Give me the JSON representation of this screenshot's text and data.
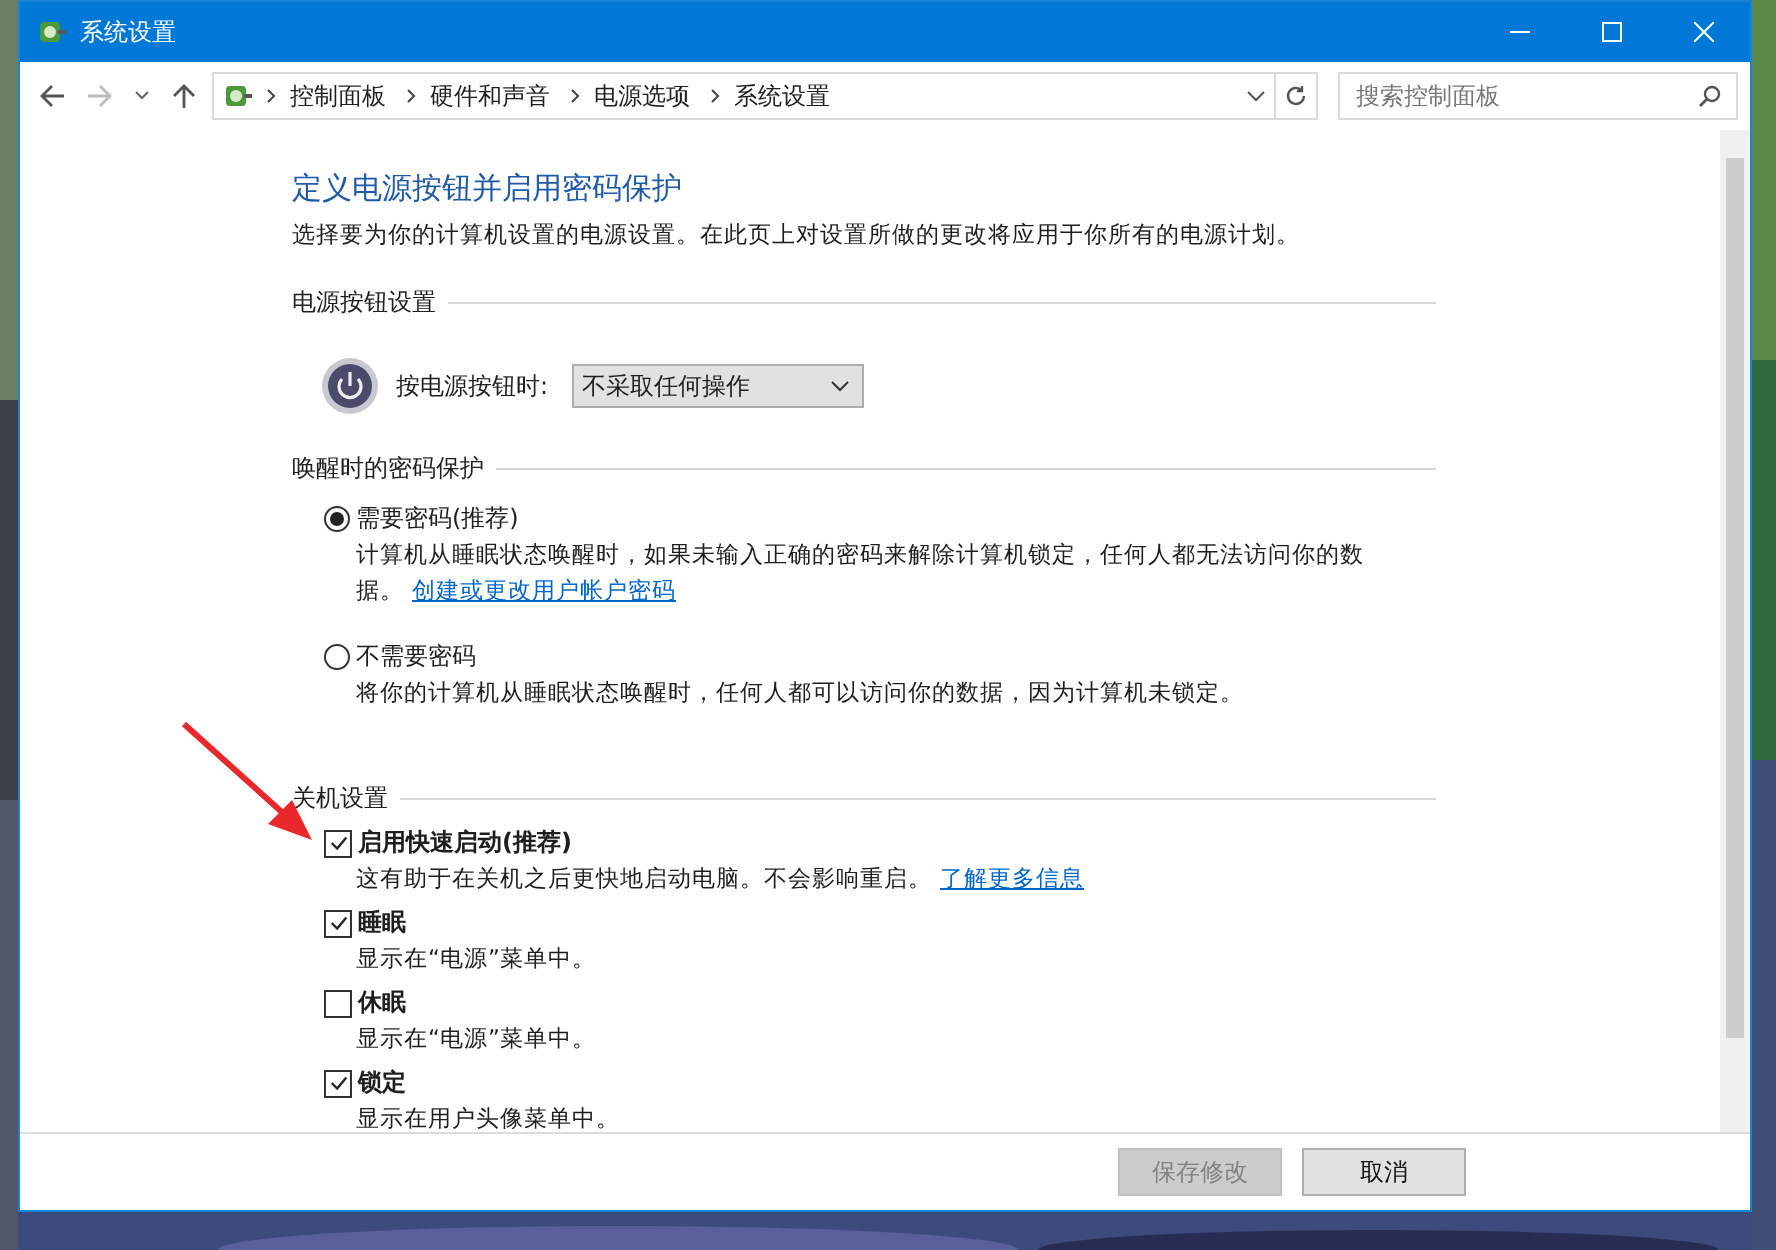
{
  "window": {
    "title": "系统设置"
  },
  "nav": {
    "forward_disabled": true,
    "breadcrumb": [
      "控制面板",
      "硬件和声音",
      "电源选项",
      "系统设置"
    ],
    "search": {
      "placeholder": "搜索控制面板"
    }
  },
  "page": {
    "title": "定义电源按钮并启用密码保护",
    "description": "选择要为你的计算机设置的电源设置。在此页上对设置所做的更改将应用于你所有的电源计划。",
    "power_section": {
      "heading": "电源按钮设置",
      "label": "按电源按钮时:",
      "value": "不采取任何操作"
    },
    "password_section": {
      "heading": "唤醒时的密码保护",
      "options": [
        {
          "label": "需要密码(推荐)",
          "selected": true,
          "description": "计算机从睡眠状态唤醒时，如果未输入正确的密码来解除计算机锁定，任何人都无法访问你的数据。",
          "link": "创建或更改用户帐户密码"
        },
        {
          "label": "不需要密码",
          "selected": false,
          "description": "将你的计算机从睡眠状态唤醒时，任何人都可以访问你的数据，因为计算机未锁定。"
        }
      ]
    },
    "shutdown_section": {
      "heading": "关机设置",
      "options": [
        {
          "label": "启用快速启动(推荐)",
          "checked": true,
          "description": "这有助于在关机之后更快地启动电脑。不会影响重启。",
          "link": "了解更多信息"
        },
        {
          "label": "睡眠",
          "checked": true,
          "description": "显示在“电源”菜单中。"
        },
        {
          "label": "休眠",
          "checked": false,
          "description": "显示在“电源”菜单中。"
        },
        {
          "label": "锁定",
          "checked": true,
          "description": "显示在用户头像菜单中。"
        }
      ]
    }
  },
  "footer": {
    "buttons": [
      {
        "label": "保存修改",
        "disabled": true
      },
      {
        "label": "取消",
        "disabled": false
      }
    ]
  },
  "annotation": {
    "kind": "arrow"
  }
}
